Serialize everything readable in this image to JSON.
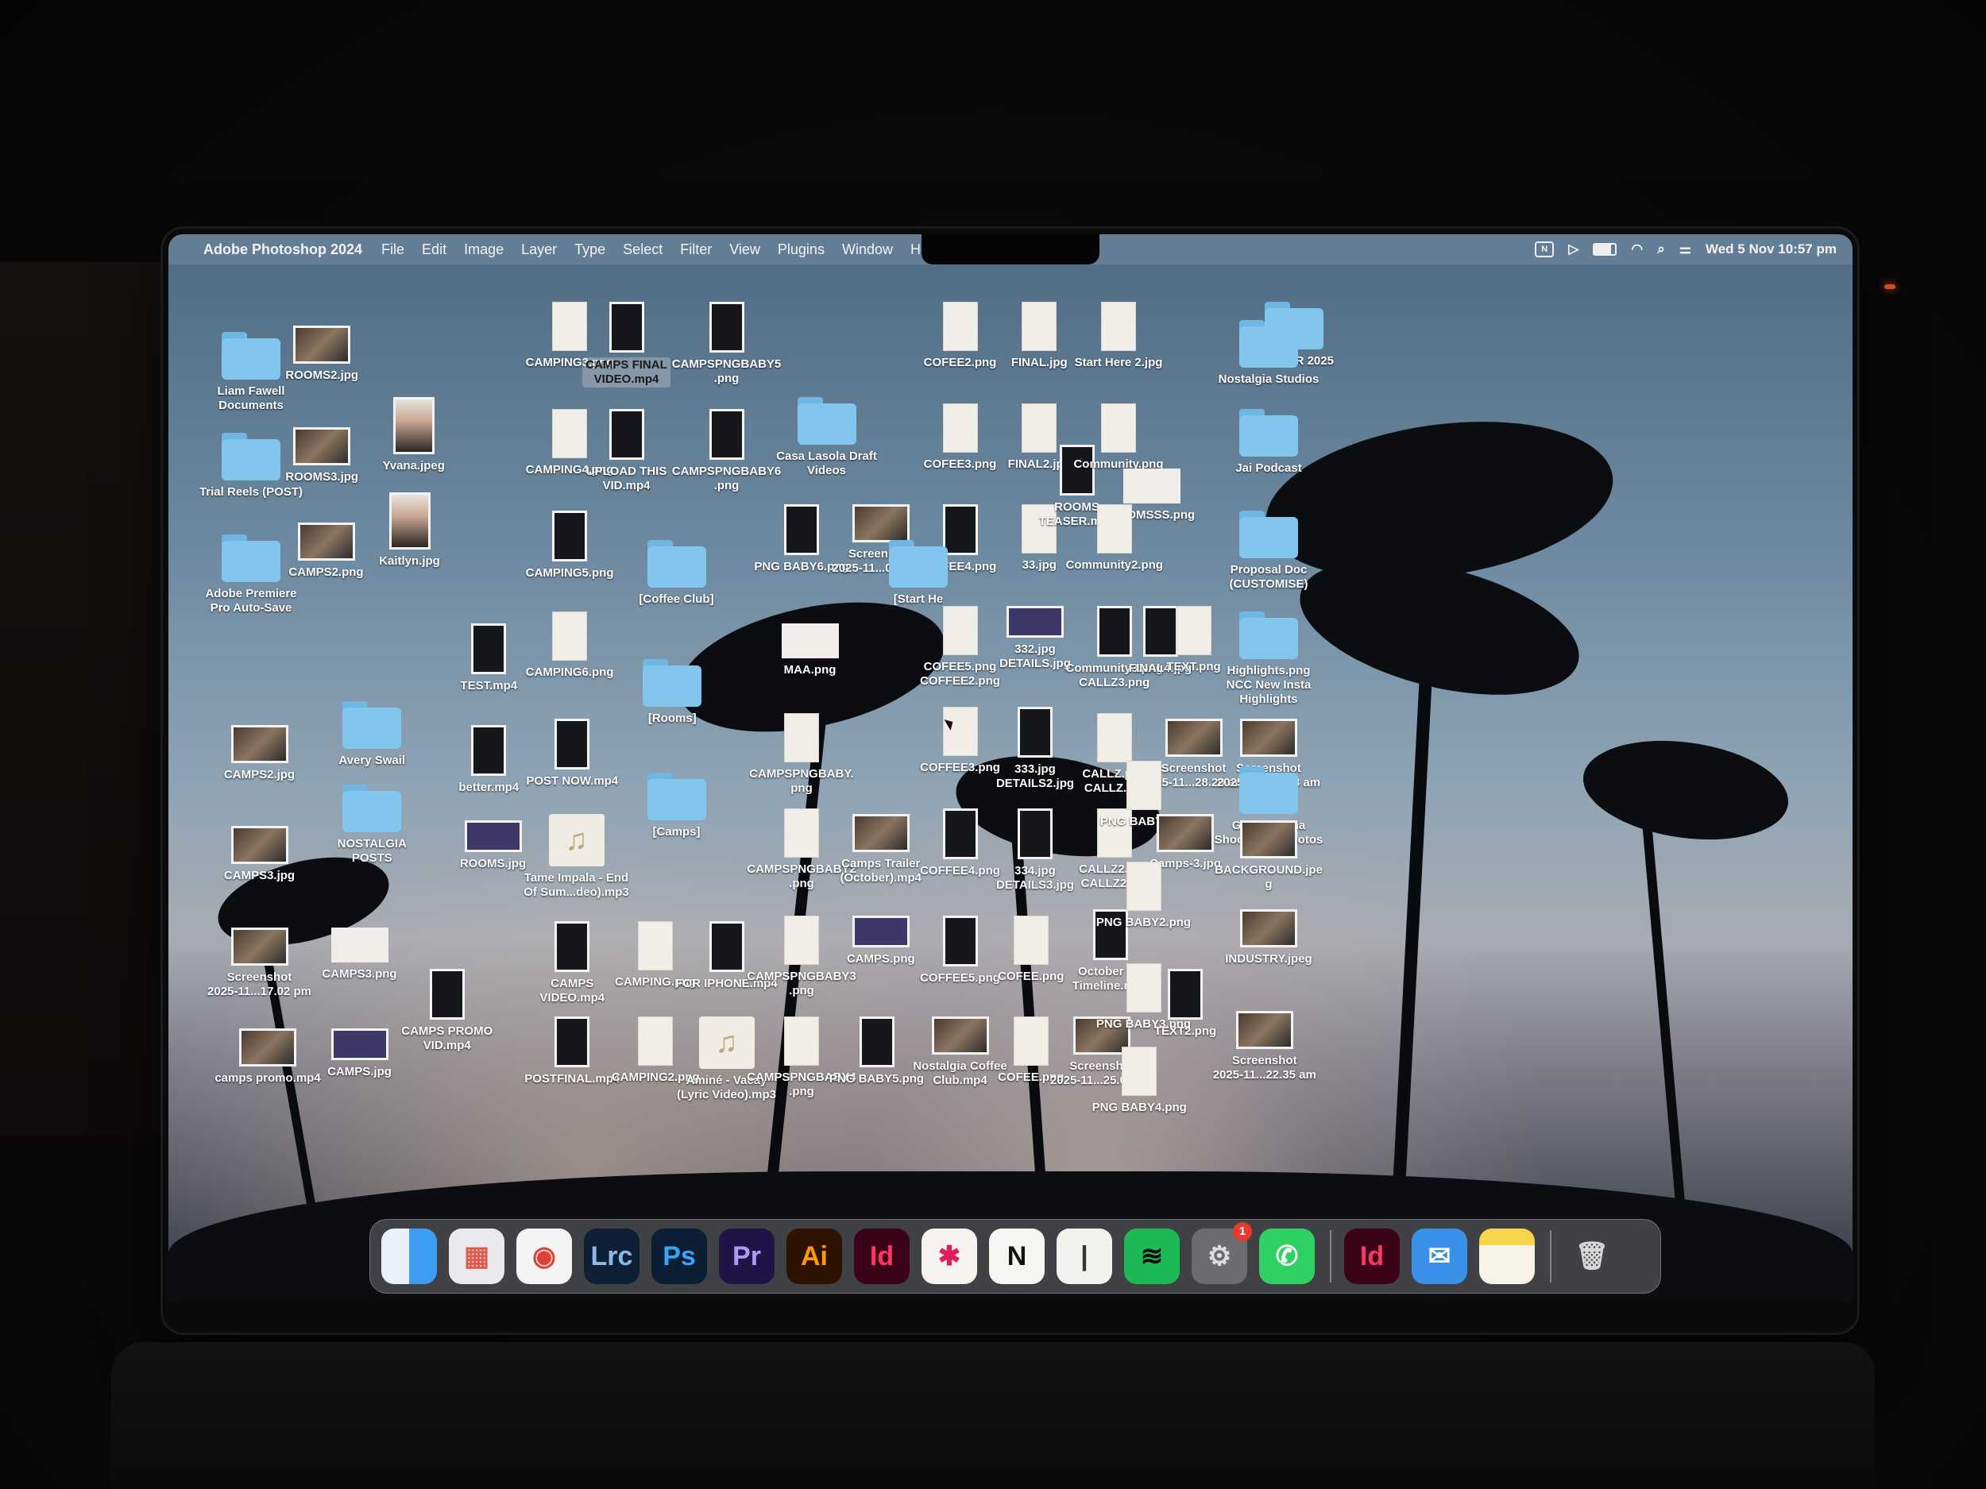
{
  "menubar": {
    "app_name": "Adobe Photoshop 2024",
    "menus": [
      "File",
      "Edit",
      "Image",
      "Layer",
      "Type",
      "Select",
      "Filter",
      "View",
      "Plugins",
      "Window",
      "Help"
    ],
    "status_icons": [
      "notion-status-icon",
      "play-icon",
      "battery-icon",
      "wifi-icon",
      "search-icon",
      "control-center-icon"
    ],
    "datetime": "Wed 5 Nov  10:57 pm"
  },
  "desktop_items": [
    {
      "label": "Liam Fawell\nDocuments",
      "kind": "folder"
    },
    {
      "label": "Trial Reels (POST)",
      "kind": "folder"
    },
    {
      "label": "Adobe Premiere\nPro Auto-Save",
      "kind": "folder"
    },
    {
      "label": "ROOMS2.jpg",
      "kind": "photo"
    },
    {
      "label": "ROOMS3.jpg",
      "kind": "photo"
    },
    {
      "label": "CAMPS2.png",
      "kind": "photo"
    },
    {
      "label": "Yvana.jpeg",
      "kind": "portrait"
    },
    {
      "label": "Kaitlyn.jpg",
      "kind": "portrait"
    },
    {
      "label": "CAMPS2.jpg",
      "kind": "photo"
    },
    {
      "label": "CAMPS3.jpg",
      "kind": "photo"
    },
    {
      "label": "Screenshot\n2025-11...17.02 pm",
      "kind": "photo"
    },
    {
      "label": "camps promo.mp4",
      "kind": "photo"
    },
    {
      "label": "Avery Swail",
      "kind": "folder"
    },
    {
      "label": "NOSTALGIA\nPOSTS",
      "kind": "folder"
    },
    {
      "label": "CAMPS3.png",
      "kind": "wide"
    },
    {
      "label": "CAMPS.jpg",
      "kind": "purple"
    },
    {
      "label": "CAMPS PROMO\nVID.mp4",
      "kind": "dark"
    },
    {
      "label": "TEST.mp4",
      "kind": "dark"
    },
    {
      "label": "better.mp4",
      "kind": "dark"
    },
    {
      "label": "ROOMS.jpg",
      "kind": "purple"
    },
    {
      "label": "CAMPING3.png",
      "kind": "doc"
    },
    {
      "label": "CAMPING4.png",
      "kind": "doc"
    },
    {
      "label": "CAMPING5.png",
      "kind": "dark"
    },
    {
      "label": "CAMPING6.png",
      "kind": "doc"
    },
    {
      "label": "POST NOW.mp4",
      "kind": "dark"
    },
    {
      "label": "Tame Impala - End\nOf Sum...deo).mp3",
      "kind": "audio"
    },
    {
      "label": "CAMPS\nVIDEO.mp4",
      "kind": "dark"
    },
    {
      "label": "POSTFINAL.mp4",
      "kind": "dark"
    },
    {
      "label": "CAMPS FINAL\nVIDEO.mp4",
      "kind": "dark",
      "selected": true
    },
    {
      "label": "UPLOAD THIS\nVID.mp4",
      "kind": "dark"
    },
    {
      "label": "[Coffee Club]",
      "kind": "folder"
    },
    {
      "label": "[Rooms]",
      "kind": "folder"
    },
    {
      "label": "[Camps]",
      "kind": "folder"
    },
    {
      "label": "CAMPING.png",
      "kind": "doc"
    },
    {
      "label": "CAMPING2.png",
      "kind": "doc"
    },
    {
      "label": "CAMPSPNGBABY5\n.png",
      "kind": "dark"
    },
    {
      "label": "CAMPSPNGBABY6\n.png",
      "kind": "dark"
    },
    {
      "label": "FOR IPHONE.mp4",
      "kind": "dark"
    },
    {
      "label": "Aminé - Vacay\n(Lyric Video).mp3",
      "kind": "audio"
    },
    {
      "label": "Casa Lasola Draft\nVideos",
      "kind": "folder"
    },
    {
      "label": "PNG BABY6.png",
      "kind": "dark"
    },
    {
      "label": "MAA.png",
      "kind": "wide"
    },
    {
      "label": "CAMPSPNGBABY.\npng",
      "kind": "doc"
    },
    {
      "label": "CAMPSPNGBABY2\n.png",
      "kind": "doc"
    },
    {
      "label": "CAMPSPNGBABY3\n.png",
      "kind": "doc"
    },
    {
      "label": "CAMPSPNGBABY4\n.png",
      "kind": "doc"
    },
    {
      "label": "Screenshot\n2025-11...0.39 pm",
      "kind": "photo"
    },
    {
      "label": "Camps Trailer\n(October).mp4",
      "kind": "photo"
    },
    {
      "label": "CAMPS.png",
      "kind": "purple"
    },
    {
      "label": "PNG BABY5.png",
      "kind": "dark"
    },
    {
      "label": "COFEE2.png",
      "kind": "doc"
    },
    {
      "label": "COFEE3.png",
      "kind": "doc"
    },
    {
      "label": "COFEE4.png",
      "kind": "dark"
    },
    {
      "label": "COFEE5.png\nCOFFEE2.png",
      "kind": "doc"
    },
    {
      "label": "COFFEE3.png",
      "kind": "doc"
    },
    {
      "label": "COFFEE4.png",
      "kind": "dark"
    },
    {
      "label": "COFFEE5.png",
      "kind": "dark"
    },
    {
      "label": "Nostalgia Coffee\nClub.mp4",
      "kind": "photo"
    },
    {
      "label": "[Start He",
      "kind": "folder"
    },
    {
      "label": "FINAL.jpg",
      "kind": "doc"
    },
    {
      "label": "FINAL2.jpg",
      "kind": "doc"
    },
    {
      "label": "33.jpg",
      "kind": "doc"
    },
    {
      "label": "332.jpg\nDETAILS.jpg",
      "kind": "purple"
    },
    {
      "label": "333.jpg\nDETAILS2.jpg",
      "kind": "dark"
    },
    {
      "label": "334.jpg\nDETAILS3.jpg",
      "kind": "dark"
    },
    {
      "label": "COFEE.png",
      "kind": "doc"
    },
    {
      "label": "COFEE.png",
      "kind": "doc"
    },
    {
      "label": "ROOMS\nTEASER.mp4",
      "kind": "dark"
    },
    {
      "label": "Start Here 2.jpg",
      "kind": "doc"
    },
    {
      "label": "Community.png",
      "kind": "doc"
    },
    {
      "label": "ROOMSSS.png",
      "kind": "wide"
    },
    {
      "label": "Community2.png",
      "kind": "doc"
    },
    {
      "label": "Community3.png\nCALLZ3.png",
      "kind": "dark"
    },
    {
      "label": "CALLZ.png\nCALLZ.jpg",
      "kind": "doc"
    },
    {
      "label": "CALLZ2.png\nCALLZ2.jpg",
      "kind": "doc"
    },
    {
      "label": "October Ad\nTimeline.mp4",
      "kind": "dark"
    },
    {
      "label": "Screenshot\n2025-11...25.03 am",
      "kind": "photo"
    },
    {
      "label": "PNG BABY4.png",
      "kind": "doc"
    },
    {
      "label": "FINAL4.jpg",
      "kind": "dark"
    },
    {
      "label": "TEXT.png",
      "kind": "doc"
    },
    {
      "label": "Screenshot\n2025-11...28.20 am",
      "kind": "photo"
    },
    {
      "label": "PNG BABY.png",
      "kind": "doc"
    },
    {
      "label": "Camps-3.jpg",
      "kind": "photo"
    },
    {
      "label": "PNG BABY2.png",
      "kind": "doc"
    },
    {
      "label": "PNG BABY3.png",
      "kind": "doc"
    },
    {
      "label": "TEXT2.png",
      "kind": "dark"
    },
    {
      "label": "MASTER 2025",
      "kind": "folder"
    },
    {
      "label": "Nostalgia Studios",
      "kind": "folder"
    },
    {
      "label": "Jai Podcast",
      "kind": "folder"
    },
    {
      "label": "Proposal Doc\n(CUSTOMISE)",
      "kind": "folder"
    },
    {
      "label": "Highlights.png\nNCC New Insta\nHighlights",
      "kind": "folder"
    },
    {
      "label": "Screenshot\n2025-11...15.58 am",
      "kind": "photo"
    },
    {
      "label": "Gold Banana\nShoot RAW Photos",
      "kind": "folder"
    },
    {
      "label": "BACKGROUND.jpe\ng",
      "kind": "photo"
    },
    {
      "label": "INDUSTRY.jpeg",
      "kind": "photo"
    },
    {
      "label": "Screenshot\n2025-11...22.35 am",
      "kind": "photo"
    }
  ],
  "dock": {
    "apps": [
      {
        "name": "finder-icon",
        "glyph": "",
        "bg": "#3d9df2",
        "fg": "#fff"
      },
      {
        "name": "launchpad-icon",
        "glyph": "▦",
        "bg": "#e9e9ee",
        "fg": "#e15a4f"
      },
      {
        "name": "chrome-icon",
        "glyph": "◉",
        "bg": "#f4f4f4",
        "fg": "#e04236"
      },
      {
        "name": "lightroom-classic-icon",
        "glyph": "Lrc",
        "bg": "#0f2036",
        "fg": "#8cb8e8"
      },
      {
        "name": "photoshop-icon",
        "glyph": "Ps",
        "bg": "#0b1e33",
        "fg": "#35a6f5"
      },
      {
        "name": "premiere-pro-icon",
        "glyph": "Pr",
        "bg": "#1f1445",
        "fg": "#a89cf7"
      },
      {
        "name": "illustrator-icon",
        "glyph": "Ai",
        "bg": "#2e1302",
        "fg": "#ff9a00"
      },
      {
        "name": "indesign-icon",
        "glyph": "Id",
        "bg": "#3a0318",
        "fg": "#ff3366"
      },
      {
        "name": "slack-icon",
        "glyph": "✱",
        "bg": "#f6f3ee",
        "fg": "#e01e5a"
      },
      {
        "name": "notion-icon",
        "glyph": "N",
        "bg": "#f7f5f0",
        "fg": "#111"
      },
      {
        "name": "blank-app-icon",
        "glyph": "|",
        "bg": "#f3f1ec",
        "fg": "#333"
      },
      {
        "name": "spotify-icon",
        "glyph": "≋",
        "bg": "#1db954",
        "fg": "#0a0a0a"
      },
      {
        "name": "system-settings-icon",
        "glyph": "⚙",
        "bg": "#6a6c70",
        "fg": "#ddd",
        "badge": "1"
      },
      {
        "name": "whatsapp-icon",
        "glyph": "✆",
        "bg": "#2fd064",
        "fg": "#fff"
      },
      {
        "name": "indesign-2-icon",
        "glyph": "Id",
        "bg": "#3a0318",
        "fg": "#ff3366",
        "after_separator": true
      },
      {
        "name": "mail-icon",
        "glyph": "✉",
        "bg": "#3a8fe8",
        "fg": "#fff"
      },
      {
        "name": "notes-icon",
        "glyph": "",
        "bg": "#f6d54a",
        "fg": "#fff"
      },
      {
        "name": "trash-icon",
        "glyph": "🗑",
        "bg": "rgba(255,255,255,0)",
        "fg": "#d8d8d8",
        "after_separator": true
      }
    ]
  }
}
